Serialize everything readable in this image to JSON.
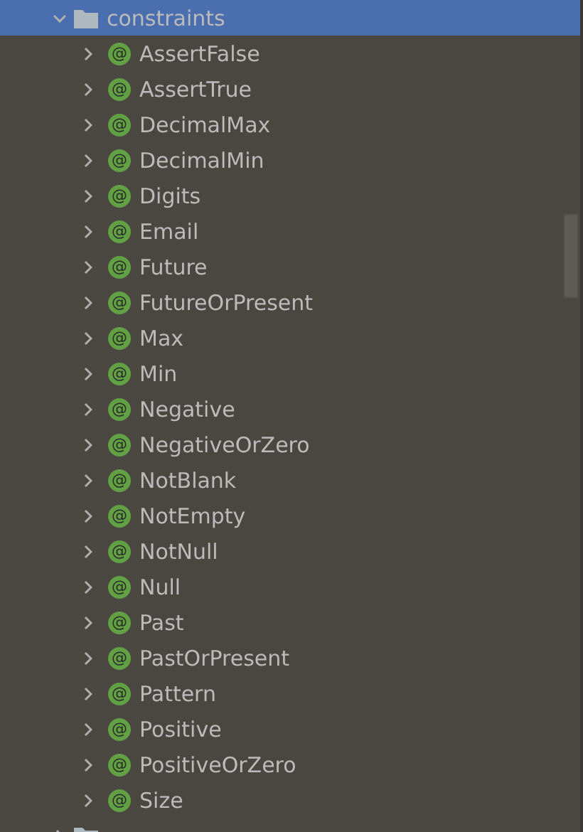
{
  "tree": [
    {
      "name": "constraints",
      "expanded": true,
      "selected": true,
      "children": [
        {
          "icon": "@",
          "name": "AssertFalse",
          "expanded": false,
          "selected": false
        },
        {
          "icon": "@",
          "name": "AssertTrue",
          "expanded": false,
          "selected": false
        },
        {
          "icon": "@",
          "name": "DecimalMax",
          "expanded": false,
          "selected": false
        },
        {
          "icon": "@",
          "name": "DecimalMin",
          "expanded": false,
          "selected": false
        },
        {
          "icon": "@",
          "name": "Digits",
          "expanded": false,
          "selected": false
        },
        {
          "icon": "@",
          "name": "Email",
          "expanded": false,
          "selected": false
        },
        {
          "icon": "@",
          "name": "Future",
          "expanded": false,
          "selected": false
        },
        {
          "icon": "@",
          "name": "FutureOrPresent",
          "expanded": false,
          "selected": false
        },
        {
          "icon": "@",
          "name": "Max",
          "expanded": false,
          "selected": false
        },
        {
          "icon": "@",
          "name": "Min",
          "expanded": false,
          "selected": false
        },
        {
          "icon": "@",
          "name": "Negative",
          "expanded": false,
          "selected": false
        },
        {
          "icon": "@",
          "name": "NegativeOrZero",
          "expanded": false,
          "selected": false
        },
        {
          "icon": "@",
          "name": "NotBlank",
          "expanded": false,
          "selected": false
        },
        {
          "icon": "@",
          "name": "NotEmpty",
          "expanded": false,
          "selected": false
        },
        {
          "icon": "@",
          "name": "NotNull",
          "expanded": false,
          "selected": false
        },
        {
          "icon": "@",
          "name": "Null",
          "expanded": false,
          "selected": false
        },
        {
          "icon": "@",
          "name": "Past",
          "expanded": false,
          "selected": false
        },
        {
          "icon": "@",
          "name": "PastOrPresent",
          "expanded": false,
          "selected": false
        },
        {
          "icon": "@",
          "name": "Pattern",
          "expanded": false,
          "selected": false
        },
        {
          "icon": "@",
          "name": "Positive",
          "expanded": false,
          "selected": false
        },
        {
          "icon": "@",
          "name": "PositiveOrZero",
          "expanded": false,
          "selected": false
        },
        {
          "icon": "@",
          "name": "Size",
          "expanded": false,
          "selected": false
        }
      ]
    },
    {
      "expanded": false,
      "selected": false
    }
  ]
}
